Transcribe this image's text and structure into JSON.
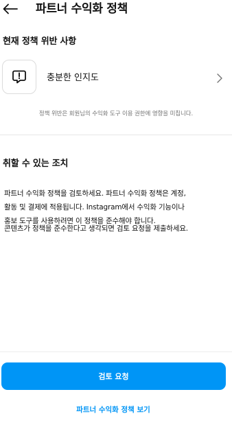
{
  "header": {
    "title": "파트너 수익화 정책",
    "back_icon": "arrow-left-icon"
  },
  "violations": {
    "heading": "현재 정책 위반 사항",
    "item": {
      "label": "충분한 인지도",
      "icon": "alert-message-icon",
      "chevron_icon": "chevron-right-icon"
    },
    "notice": "정책 위반은 회원님의 수익화 도구 이용 권한에 영향을 미칩니다."
  },
  "actions": {
    "heading": "취할 수 있는 조치",
    "paragraph1_line1": "파트너 수익화 정책을 검토하세요. 파트너 수익화 정책은 계정,",
    "paragraph1_line2": "활동 및 결제에 적용됩니다. Instagram에서 수익화 기능이나",
    "paragraph1_line3": "홍보 도구를 사용하려면 이 정책을 준수해야 합니다.",
    "paragraph2": "콘텐츠가 정책을 준수한다고 생각되면 검토 요청을 제출하세요."
  },
  "footer": {
    "primary_button": "검토 요청",
    "link": "파트너 수익화 정책 보기"
  },
  "colors": {
    "accent": "#0095f6",
    "text": "#111111",
    "muted": "#737373",
    "border": "#dbdbdb"
  }
}
